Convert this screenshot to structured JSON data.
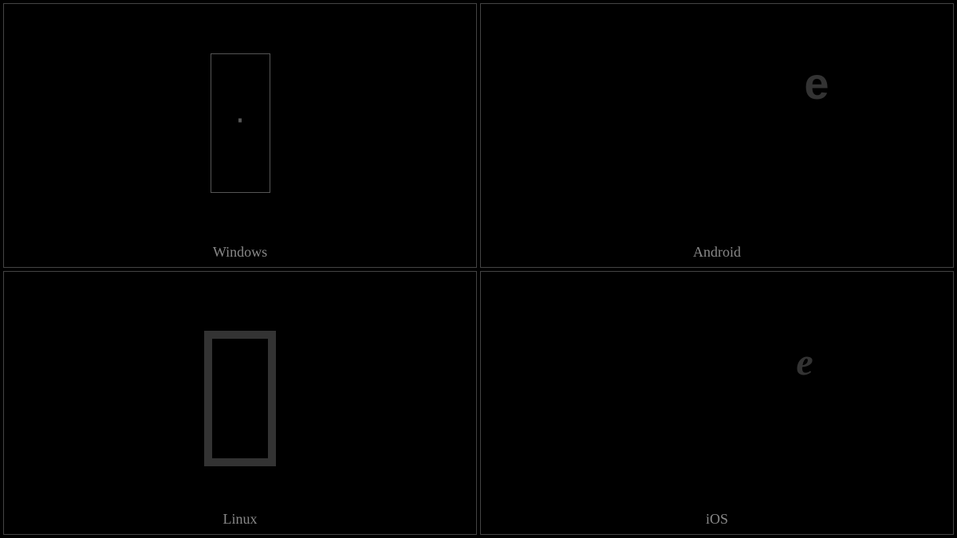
{
  "cells": [
    {
      "id": "windows",
      "label": "Windows",
      "glyph_type": "missing-box-thin"
    },
    {
      "id": "android",
      "label": "Android",
      "glyph": "e",
      "glyph_style": "sans-bold"
    },
    {
      "id": "linux",
      "label": "Linux",
      "glyph_type": "missing-box-thick"
    },
    {
      "id": "ios",
      "label": "iOS",
      "glyph": "e",
      "glyph_style": "cursive-italic"
    }
  ]
}
